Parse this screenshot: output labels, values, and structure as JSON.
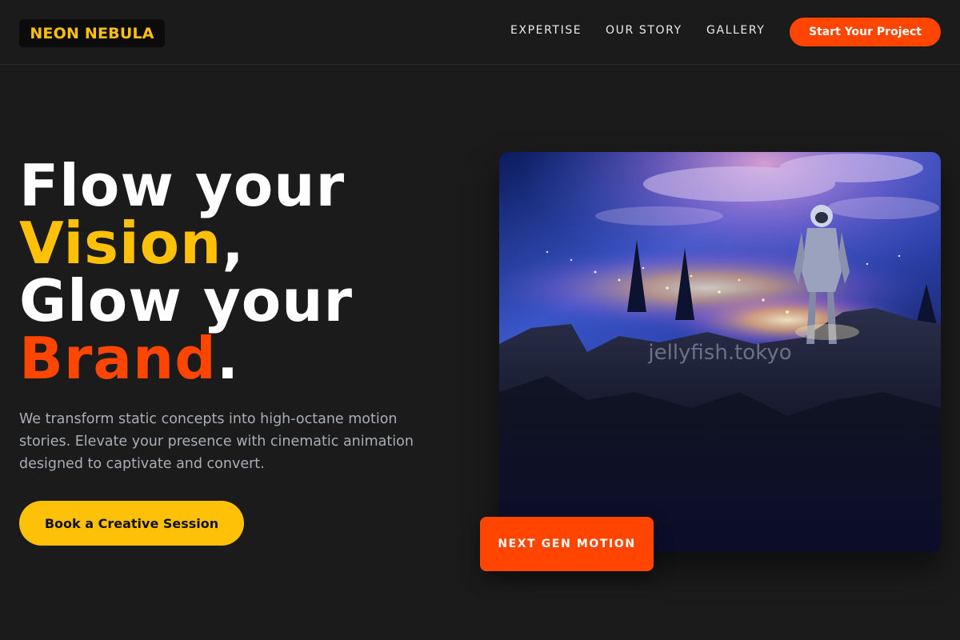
{
  "header": {
    "logo": "NEON NEBULA",
    "nav": [
      {
        "label": "EXPERTISE"
      },
      {
        "label": "OUR STORY"
      },
      {
        "label": "GALLERY"
      }
    ],
    "cta_label": "Start Your Project"
  },
  "hero": {
    "headline": {
      "line1": "Flow your",
      "word_vision": "Vision",
      "comma": ",",
      "line3": "Glow your",
      "word_brand": "Brand",
      "period": "."
    },
    "subtext": "We transform static concepts into high-octane motion stories. Elevate your presence with cinematic animation designed to captivate and convert.",
    "cta_label": "Book a Creative Session",
    "image_watermark": "jellyfish.tokyo",
    "badge": "NEXT GEN MOTION"
  },
  "colors": {
    "background": "#1b1b1b",
    "accent_yellow": "#ffc107",
    "accent_orange": "#ff4500",
    "body_text": "#a9aeb6"
  }
}
